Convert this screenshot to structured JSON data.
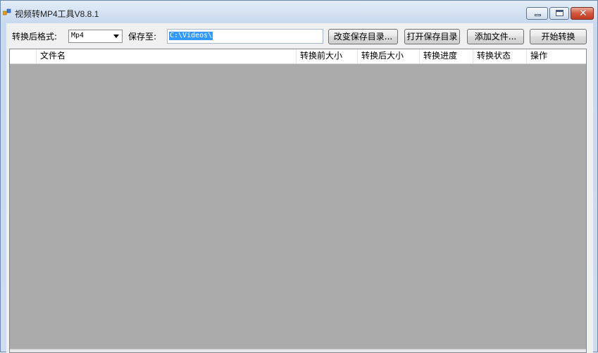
{
  "window": {
    "title": "视频转MP4工具V8.8.1",
    "close_glyph": "✕"
  },
  "toolbar": {
    "format_label": "转换后格式:",
    "format_selected": "Mp4",
    "save_label": "保存至:",
    "save_path": "C:\\Videos\\",
    "change_dir_button": "改变保存目录...",
    "open_dir_button": "打开保存目录",
    "add_file_button": "添加文件...",
    "start_button": "开始转换"
  },
  "table": {
    "columns": [
      "",
      "文件名",
      "转换前大小",
      "转换后大小",
      "转换进度",
      "转换状态",
      "操作"
    ]
  },
  "colors": {
    "selection": "#3399ff",
    "list_background": "#ababab",
    "close_button": "#c23b22"
  }
}
